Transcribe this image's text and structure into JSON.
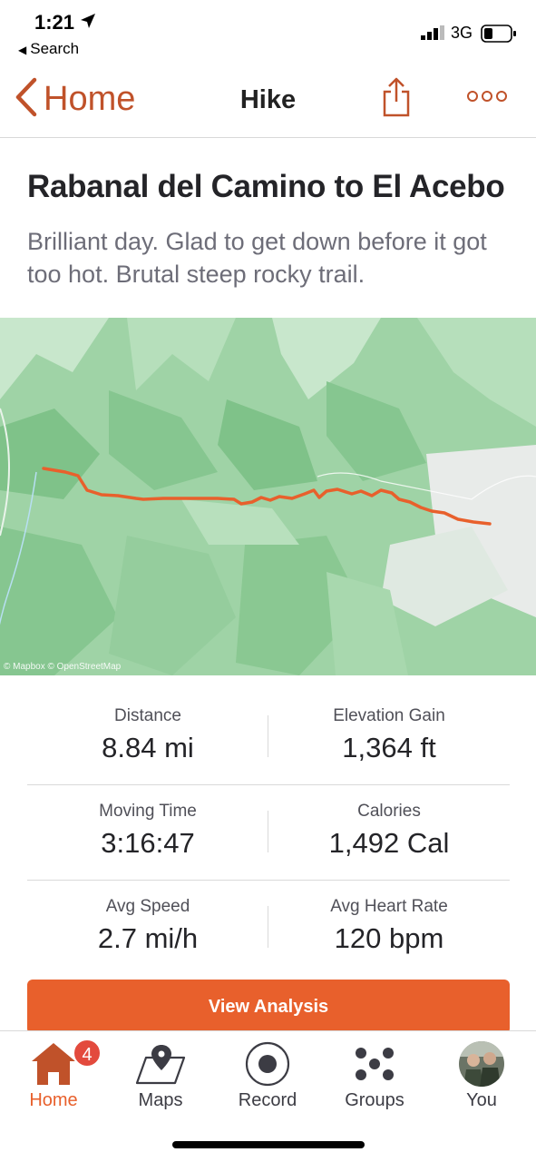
{
  "status_bar": {
    "time": "1:21",
    "back_label": "Search",
    "network": "3G"
  },
  "nav": {
    "back_label": "Home",
    "title": "Hike"
  },
  "activity": {
    "title": "Rabanal del Camino to El Acebo",
    "description": "Brilliant day.  Glad to get down before it got too hot.  Brutal steep rocky trail."
  },
  "map": {
    "attribution": "© Mapbox © OpenStreetMap",
    "route_color": "#e8602c"
  },
  "stats": [
    [
      {
        "label": "Distance",
        "value": "8.84 mi"
      },
      {
        "label": "Elevation Gain",
        "value": "1,364 ft"
      }
    ],
    [
      {
        "label": "Moving Time",
        "value": "3:16:47"
      },
      {
        "label": "Calories",
        "value": "1,492 Cal"
      }
    ],
    [
      {
        "label": "Avg Speed",
        "value": "2.7 mi/h"
      },
      {
        "label": "Avg Heart Rate",
        "value": "120 bpm"
      }
    ]
  ],
  "analysis_button": "View Analysis",
  "tabs": [
    {
      "label": "Home",
      "icon": "home-icon",
      "badge": "4",
      "active": true
    },
    {
      "label": "Maps",
      "icon": "map-icon"
    },
    {
      "label": "Record",
      "icon": "record-icon"
    },
    {
      "label": "Groups",
      "icon": "groups-icon"
    },
    {
      "label": "You",
      "icon": "avatar"
    }
  ],
  "colors": {
    "accent": "#e8602c",
    "nav_accent": "#c0522a",
    "badge": "#e34a3d"
  }
}
